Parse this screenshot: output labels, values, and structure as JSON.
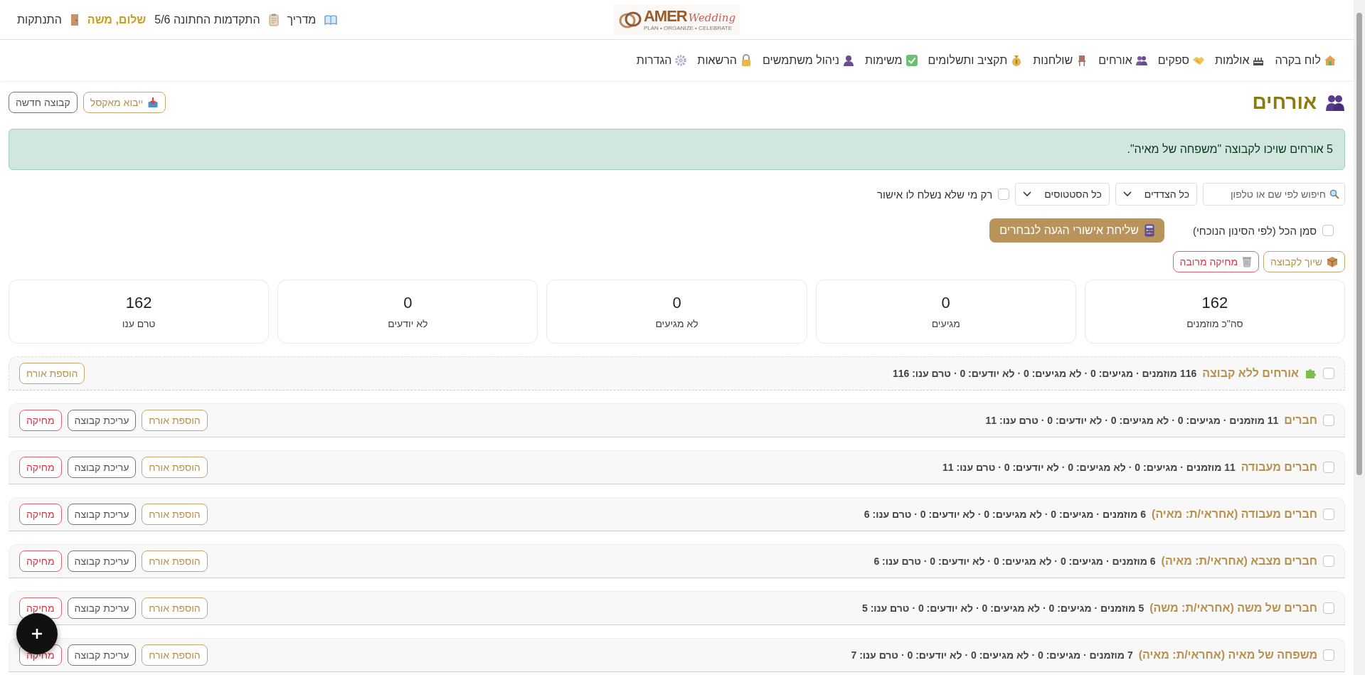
{
  "header": {
    "logo": {
      "wordmark": "AMER",
      "script": "Wedding",
      "tagline": "PLAN • ORGANIZE • CELEBRATE"
    },
    "links": [
      {
        "kind": "guide",
        "label": "מדריך"
      },
      {
        "kind": "progress",
        "label": "התקדמות החתונה 5/6"
      },
      {
        "kind": "greeting",
        "label": "שלום, משה"
      },
      {
        "kind": "logout",
        "label": "התנתקות"
      }
    ]
  },
  "nav": [
    {
      "label": "לוח בקרה"
    },
    {
      "label": "אולמות"
    },
    {
      "label": "ספקים"
    },
    {
      "label": "אורחים"
    },
    {
      "label": "שולחנות"
    },
    {
      "label": "תקציב ותשלומים"
    },
    {
      "label": "משימות"
    },
    {
      "label": "ניהול משתמשים"
    },
    {
      "label": "הרשאות"
    },
    {
      "label": "הגדרות"
    }
  ],
  "page": {
    "title": "אורחים",
    "actions": [
      {
        "kind": "import",
        "label": "ייבוא מאקסל"
      },
      {
        "kind": "new",
        "label": "קבוצה חדשה"
      }
    ]
  },
  "alert": "5 אורחים שויכו לקבוצה \"משפחה של מאיה\".",
  "filters": {
    "search": {
      "placeholder": "חיפוש לפי שם או טלפון"
    },
    "selects": [
      "כל הצדדים",
      "כל הסטטוסים"
    ],
    "unsent_only": {
      "label": "רק מי שלא נשלח לו אישור",
      "checked": false
    }
  },
  "select_all": {
    "label": "סמן הכל (לפי הסינון הנוכחי)",
    "checked": false
  },
  "send_button": "שליחת אישורי הגעה לנבחרים",
  "bulk_actions": [
    {
      "kind": "assign",
      "label": "שיוך לקבוצה"
    },
    {
      "kind": "delete",
      "label": "מחיקה מרובה"
    }
  ],
  "stats": [
    {
      "value": "162",
      "label": "סה\"כ מוזמנים"
    },
    {
      "value": "0",
      "label": "מגיעים"
    },
    {
      "value": "0",
      "label": "לא מגיעים"
    },
    {
      "value": "0",
      "label": "לא יודעים"
    },
    {
      "value": "162",
      "label": "טרם ענו"
    }
  ],
  "groups": [
    {
      "kind": "ungrouped",
      "checked": false,
      "name": "אורחים ללא קבוצה",
      "summary": "116 מוזמנים · מגיעים: 0 · לא מגיעים: 0 · לא יודעים: 0 · טרם ענו: 116",
      "actions": [
        {
          "kind": "add",
          "label": "הוספת אורח"
        }
      ]
    },
    {
      "kind": "group",
      "checked": false,
      "name": "חברים",
      "summary": "11 מוזמנים · מגיעים: 0 · לא מגיעים: 0 · לא יודעים: 0 · טרם ענו: 11",
      "actions": [
        {
          "kind": "add",
          "label": "הוספת אורח"
        },
        {
          "kind": "edit",
          "label": "עריכת קבוצה"
        },
        {
          "kind": "delete",
          "label": "מחיקה"
        }
      ]
    },
    {
      "kind": "group",
      "checked": false,
      "name": "חברים מעבודה",
      "summary": "11 מוזמנים · מגיעים: 0 · לא מגיעים: 0 · לא יודעים: 0 · טרם ענו: 11",
      "actions": [
        {
          "kind": "add",
          "label": "הוספת אורח"
        },
        {
          "kind": "edit",
          "label": "עריכת קבוצה"
        },
        {
          "kind": "delete",
          "label": "מחיקה"
        }
      ]
    },
    {
      "kind": "group",
      "checked": false,
      "name": "חברים מעבודה (אחראי/ת: מאיה)",
      "summary": "6 מוזמנים · מגיעים: 0 · לא מגיעים: 0 · לא יודעים: 0 · טרם ענו: 6",
      "actions": [
        {
          "kind": "add",
          "label": "הוספת אורח"
        },
        {
          "kind": "edit",
          "label": "עריכת קבוצה"
        },
        {
          "kind": "delete",
          "label": "מחיקה"
        }
      ]
    },
    {
      "kind": "group",
      "checked": false,
      "name": "חברים מצבא (אחראי/ת: מאיה)",
      "summary": "6 מוזמנים · מגיעים: 0 · לא מגיעים: 0 · לא יודעים: 0 · טרם ענו: 6",
      "actions": [
        {
          "kind": "add",
          "label": "הוספת אורח"
        },
        {
          "kind": "edit",
          "label": "עריכת קבוצה"
        },
        {
          "kind": "delete",
          "label": "מחיקה"
        }
      ]
    },
    {
      "kind": "group",
      "checked": false,
      "name": "חברים של משה (אחראי/ת: משה)",
      "summary": "5 מוזמנים · מגיעים: 0 · לא מגיעים: 0 · לא יודעים: 0 · טרם ענו: 5",
      "actions": [
        {
          "kind": "add",
          "label": "הוספת אורח"
        },
        {
          "kind": "edit",
          "label": "עריכת קבוצה"
        },
        {
          "kind": "delete",
          "label": "מחיקה"
        }
      ]
    },
    {
      "kind": "group",
      "checked": false,
      "name": "משפחה של מאיה (אחראי/ת: מאיה)",
      "summary": "7 מוזמנים · מגיעים: 0 · לא מגיעים: 0 · לא יודעים: 0 · טרם ענו: 7",
      "actions": [
        {
          "kind": "add",
          "label": "הוספת אורח"
        },
        {
          "kind": "edit",
          "label": "עריכת קבוצה"
        },
        {
          "kind": "delete",
          "label": "מחיקה"
        }
      ]
    }
  ]
}
